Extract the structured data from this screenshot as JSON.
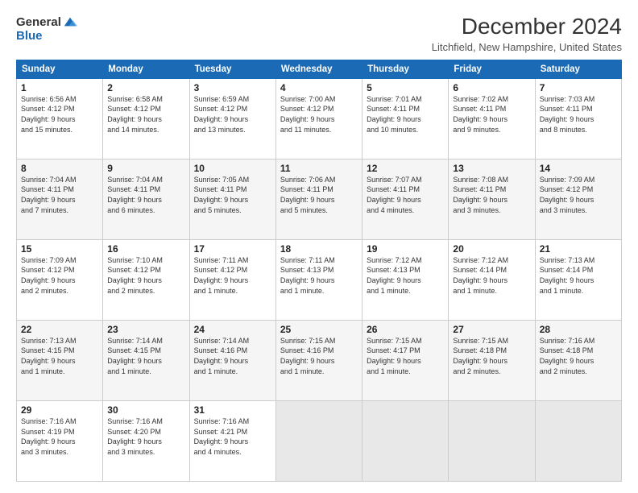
{
  "logo": {
    "general": "General",
    "blue": "Blue"
  },
  "title": "December 2024",
  "location": "Litchfield, New Hampshire, United States",
  "days_of_week": [
    "Sunday",
    "Monday",
    "Tuesday",
    "Wednesday",
    "Thursday",
    "Friday",
    "Saturday"
  ],
  "weeks": [
    [
      {
        "day": "1",
        "info": "Sunrise: 6:56 AM\nSunset: 4:12 PM\nDaylight: 9 hours\nand 15 minutes."
      },
      {
        "day": "2",
        "info": "Sunrise: 6:58 AM\nSunset: 4:12 PM\nDaylight: 9 hours\nand 14 minutes."
      },
      {
        "day": "3",
        "info": "Sunrise: 6:59 AM\nSunset: 4:12 PM\nDaylight: 9 hours\nand 13 minutes."
      },
      {
        "day": "4",
        "info": "Sunrise: 7:00 AM\nSunset: 4:12 PM\nDaylight: 9 hours\nand 11 minutes."
      },
      {
        "day": "5",
        "info": "Sunrise: 7:01 AM\nSunset: 4:11 PM\nDaylight: 9 hours\nand 10 minutes."
      },
      {
        "day": "6",
        "info": "Sunrise: 7:02 AM\nSunset: 4:11 PM\nDaylight: 9 hours\nand 9 minutes."
      },
      {
        "day": "7",
        "info": "Sunrise: 7:03 AM\nSunset: 4:11 PM\nDaylight: 9 hours\nand 8 minutes."
      }
    ],
    [
      {
        "day": "8",
        "info": "Sunrise: 7:04 AM\nSunset: 4:11 PM\nDaylight: 9 hours\nand 7 minutes."
      },
      {
        "day": "9",
        "info": "Sunrise: 7:04 AM\nSunset: 4:11 PM\nDaylight: 9 hours\nand 6 minutes."
      },
      {
        "day": "10",
        "info": "Sunrise: 7:05 AM\nSunset: 4:11 PM\nDaylight: 9 hours\nand 5 minutes."
      },
      {
        "day": "11",
        "info": "Sunrise: 7:06 AM\nSunset: 4:11 PM\nDaylight: 9 hours\nand 5 minutes."
      },
      {
        "day": "12",
        "info": "Sunrise: 7:07 AM\nSunset: 4:11 PM\nDaylight: 9 hours\nand 4 minutes."
      },
      {
        "day": "13",
        "info": "Sunrise: 7:08 AM\nSunset: 4:11 PM\nDaylight: 9 hours\nand 3 minutes."
      },
      {
        "day": "14",
        "info": "Sunrise: 7:09 AM\nSunset: 4:12 PM\nDaylight: 9 hours\nand 3 minutes."
      }
    ],
    [
      {
        "day": "15",
        "info": "Sunrise: 7:09 AM\nSunset: 4:12 PM\nDaylight: 9 hours\nand 2 minutes."
      },
      {
        "day": "16",
        "info": "Sunrise: 7:10 AM\nSunset: 4:12 PM\nDaylight: 9 hours\nand 2 minutes."
      },
      {
        "day": "17",
        "info": "Sunrise: 7:11 AM\nSunset: 4:12 PM\nDaylight: 9 hours\nand 1 minute."
      },
      {
        "day": "18",
        "info": "Sunrise: 7:11 AM\nSunset: 4:13 PM\nDaylight: 9 hours\nand 1 minute."
      },
      {
        "day": "19",
        "info": "Sunrise: 7:12 AM\nSunset: 4:13 PM\nDaylight: 9 hours\nand 1 minute."
      },
      {
        "day": "20",
        "info": "Sunrise: 7:12 AM\nSunset: 4:14 PM\nDaylight: 9 hours\nand 1 minute."
      },
      {
        "day": "21",
        "info": "Sunrise: 7:13 AM\nSunset: 4:14 PM\nDaylight: 9 hours\nand 1 minute."
      }
    ],
    [
      {
        "day": "22",
        "info": "Sunrise: 7:13 AM\nSunset: 4:15 PM\nDaylight: 9 hours\nand 1 minute."
      },
      {
        "day": "23",
        "info": "Sunrise: 7:14 AM\nSunset: 4:15 PM\nDaylight: 9 hours\nand 1 minute."
      },
      {
        "day": "24",
        "info": "Sunrise: 7:14 AM\nSunset: 4:16 PM\nDaylight: 9 hours\nand 1 minute."
      },
      {
        "day": "25",
        "info": "Sunrise: 7:15 AM\nSunset: 4:16 PM\nDaylight: 9 hours\nand 1 minute."
      },
      {
        "day": "26",
        "info": "Sunrise: 7:15 AM\nSunset: 4:17 PM\nDaylight: 9 hours\nand 1 minute."
      },
      {
        "day": "27",
        "info": "Sunrise: 7:15 AM\nSunset: 4:18 PM\nDaylight: 9 hours\nand 2 minutes."
      },
      {
        "day": "28",
        "info": "Sunrise: 7:16 AM\nSunset: 4:18 PM\nDaylight: 9 hours\nand 2 minutes."
      }
    ],
    [
      {
        "day": "29",
        "info": "Sunrise: 7:16 AM\nSunset: 4:19 PM\nDaylight: 9 hours\nand 3 minutes."
      },
      {
        "day": "30",
        "info": "Sunrise: 7:16 AM\nSunset: 4:20 PM\nDaylight: 9 hours\nand 3 minutes."
      },
      {
        "day": "31",
        "info": "Sunrise: 7:16 AM\nSunset: 4:21 PM\nDaylight: 9 hours\nand 4 minutes."
      },
      {
        "day": "",
        "info": ""
      },
      {
        "day": "",
        "info": ""
      },
      {
        "day": "",
        "info": ""
      },
      {
        "day": "",
        "info": ""
      }
    ]
  ]
}
